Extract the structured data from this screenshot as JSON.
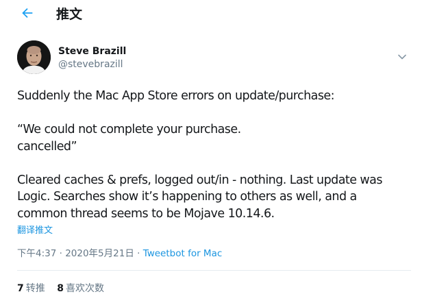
{
  "header": {
    "title": "推文",
    "back_icon": "arrow-left-icon"
  },
  "colors": {
    "accent": "#1da1f2",
    "link": "#1b95e0",
    "text": "#14171a",
    "muted": "#657786"
  },
  "author": {
    "name": "Steve Brazill",
    "handle": "@stevebrazill"
  },
  "tweet": {
    "lines": [
      "Suddenly the Mac App Store errors on update/purchase:",
      "",
      "“We could not complete your purchase.",
      "cancelled”",
      "",
      "Cleared caches & prefs, logged out/in - nothing. Last update was",
      "Logic. Searches show it’s happening to others as well, and a",
      "common thread seems to be Mojave 10.14.6."
    ],
    "translate_label": "翻译推文"
  },
  "meta": {
    "time": "下午4:37",
    "sep1": " · ",
    "date": "2020年5月21日",
    "sep2": " · ",
    "source": "Tweetbot for Mac"
  },
  "stats": {
    "retweets_count": "7",
    "retweets_label": "转推",
    "likes_count": "8",
    "likes_label": "喜欢次数"
  }
}
